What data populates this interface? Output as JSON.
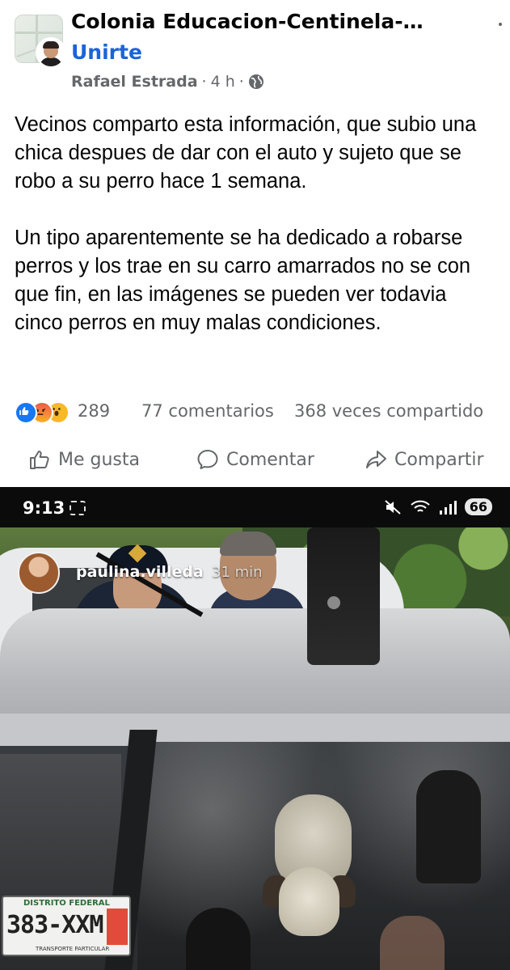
{
  "header": {
    "group_name": "Colonia Educacion-Centinela-…",
    "join_label": "Unirte",
    "author": "Rafael Estrada",
    "time": "4 h",
    "separator": "·"
  },
  "post": {
    "paragraphs": [
      "Vecinos comparto esta información, que subio una chica despues de dar con el auto y sujeto que se robo a su perro hace 1 semana.",
      "Un tipo aparentemente se ha dedicado a robarse perros y los trae en su carro amarrados no se con que fin, en las imágenes se pueden ver todavia cinco perros en muy malas condiciones."
    ]
  },
  "reactions": {
    "icons": [
      "like-icon",
      "angry-icon",
      "wow-icon"
    ],
    "count": "289",
    "comments": "77 comentarios",
    "shares": "368 veces compartido"
  },
  "actions": {
    "like": "Me gusta",
    "comment": "Comentar",
    "share": "Compartir"
  },
  "screenshot": {
    "status_time": "9:13",
    "battery": "66",
    "story_user": "paulina.villeda",
    "story_time": "31 min",
    "plate_state": "DISTRITO FEDERAL",
    "plate_number": "383-XXM",
    "plate_footer": "TRANSPORTE PARTICULAR"
  },
  "colors": {
    "link_blue": "#1b64d8",
    "secondary_text": "#65676b",
    "like_blue": "#1877f2"
  }
}
